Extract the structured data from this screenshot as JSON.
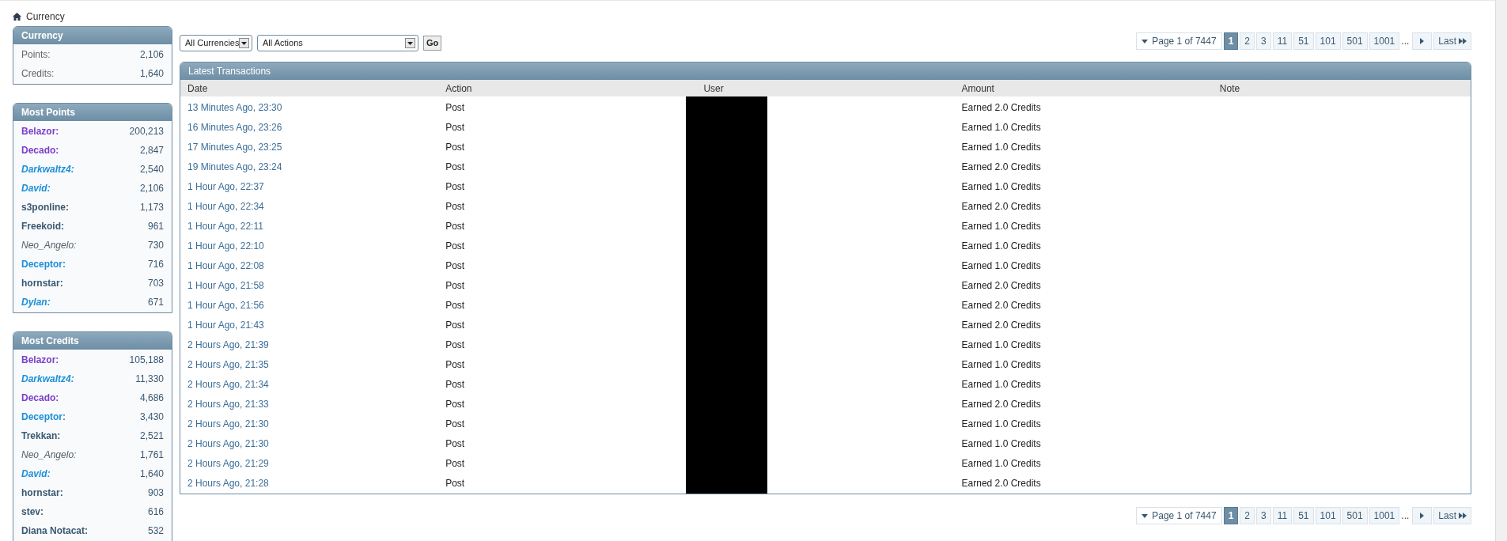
{
  "breadcrumb": {
    "label": "Currency"
  },
  "sidebar": [
    {
      "title": "Currency",
      "kind": "stats",
      "items": [
        {
          "label": "Points:",
          "value": "2,106"
        },
        {
          "label": "Credits:",
          "value": "1,640"
        }
      ]
    },
    {
      "title": "Most Points",
      "kind": "users",
      "items": [
        {
          "label": "Belazor:",
          "value": "200,213",
          "color": "#7b3fc9",
          "bold": true,
          "italic": false
        },
        {
          "label": "Decado:",
          "value": "2,847",
          "color": "#7b3fc9",
          "bold": true,
          "italic": false
        },
        {
          "label": "Darkwaltz4:",
          "value": "2,540",
          "color": "#1c8fd8",
          "bold": true,
          "italic": true
        },
        {
          "label": "David:",
          "value": "2,106",
          "color": "#1c8fd8",
          "bold": true,
          "italic": true
        },
        {
          "label": "s3ponline:",
          "value": "1,173",
          "color": "#3b5870",
          "bold": true,
          "italic": false
        },
        {
          "label": "Freekoid:",
          "value": "961",
          "color": "#3b5870",
          "bold": true,
          "italic": false
        },
        {
          "label": "Neo_Angelo:",
          "value": "730",
          "color": "#55606a",
          "bold": false,
          "italic": true
        },
        {
          "label": "Deceptor:",
          "value": "716",
          "color": "#1c8fd8",
          "bold": true,
          "italic": false
        },
        {
          "label": "hornstar:",
          "value": "703",
          "color": "#3b5870",
          "bold": true,
          "italic": false
        },
        {
          "label": "Dylan:",
          "value": "671",
          "color": "#1c8fd8",
          "bold": true,
          "italic": true
        }
      ]
    },
    {
      "title": "Most Credits",
      "kind": "users",
      "items": [
        {
          "label": "Belazor:",
          "value": "105,188",
          "color": "#7b3fc9",
          "bold": true,
          "italic": false
        },
        {
          "label": "Darkwaltz4:",
          "value": "11,330",
          "color": "#1c8fd8",
          "bold": true,
          "italic": true
        },
        {
          "label": "Decado:",
          "value": "4,686",
          "color": "#7b3fc9",
          "bold": true,
          "italic": false
        },
        {
          "label": "Deceptor:",
          "value": "3,430",
          "color": "#1c8fd8",
          "bold": true,
          "italic": false
        },
        {
          "label": "Trekkan:",
          "value": "2,521",
          "color": "#3b5870",
          "bold": true,
          "italic": false
        },
        {
          "label": "Neo_Angelo:",
          "value": "1,761",
          "color": "#55606a",
          "bold": false,
          "italic": true
        },
        {
          "label": "David:",
          "value": "1,640",
          "color": "#1c8fd8",
          "bold": true,
          "italic": true
        },
        {
          "label": "hornstar:",
          "value": "903",
          "color": "#3b5870",
          "bold": true,
          "italic": false
        },
        {
          "label": "stev:",
          "value": "616",
          "color": "#3b5870",
          "bold": true,
          "italic": false
        },
        {
          "label": "Diana Notacat:",
          "value": "532",
          "color": "#3b5870",
          "bold": true,
          "italic": false
        }
      ]
    }
  ],
  "filters": {
    "currency": "All Currencies",
    "action": "All Actions",
    "button": "Go"
  },
  "pagination": [
    {
      "summary": "Page 1 of 7447",
      "pages": [
        {
          "label": "1",
          "selected": true
        },
        {
          "label": "2",
          "selected": false
        },
        {
          "label": "3",
          "selected": false
        },
        {
          "label": "11",
          "selected": false
        },
        {
          "label": "51",
          "selected": false
        },
        {
          "label": "101",
          "selected": false
        },
        {
          "label": "501",
          "selected": false
        },
        {
          "label": "1001",
          "selected": false
        }
      ],
      "ellipsis": "...",
      "last": "Last"
    },
    {
      "summary": "Page 1 of 7447",
      "pages": [
        {
          "label": "1",
          "selected": true
        },
        {
          "label": "2",
          "selected": false
        },
        {
          "label": "3",
          "selected": false
        },
        {
          "label": "11",
          "selected": false
        },
        {
          "label": "51",
          "selected": false
        },
        {
          "label": "101",
          "selected": false
        },
        {
          "label": "501",
          "selected": false
        },
        {
          "label": "1001",
          "selected": false
        }
      ],
      "ellipsis": "...",
      "last": "Last"
    }
  ],
  "table": {
    "title": "Latest Transactions",
    "columns": [
      "Date",
      "Action",
      "User",
      "Amount",
      "Note"
    ],
    "user_column_redacted": true,
    "rows": [
      {
        "date": "13 Minutes Ago, 23:30",
        "action": "Post",
        "amount": "Earned 2.0 Credits"
      },
      {
        "date": "16 Minutes Ago, 23:26",
        "action": "Post",
        "amount": "Earned 1.0 Credits"
      },
      {
        "date": "17 Minutes Ago, 23:25",
        "action": "Post",
        "amount": "Earned 1.0 Credits"
      },
      {
        "date": "19 Minutes Ago, 23:24",
        "action": "Post",
        "amount": "Earned 2.0 Credits"
      },
      {
        "date": "1 Hour Ago, 22:37",
        "action": "Post",
        "amount": "Earned 1.0 Credits"
      },
      {
        "date": "1 Hour Ago, 22:34",
        "action": "Post",
        "amount": "Earned 2.0 Credits"
      },
      {
        "date": "1 Hour Ago, 22:11",
        "action": "Post",
        "amount": "Earned 1.0 Credits"
      },
      {
        "date": "1 Hour Ago, 22:10",
        "action": "Post",
        "amount": "Earned 1.0 Credits"
      },
      {
        "date": "1 Hour Ago, 22:08",
        "action": "Post",
        "amount": "Earned 1.0 Credits"
      },
      {
        "date": "1 Hour Ago, 21:58",
        "action": "Post",
        "amount": "Earned 2.0 Credits"
      },
      {
        "date": "1 Hour Ago, 21:56",
        "action": "Post",
        "amount": "Earned 2.0 Credits"
      },
      {
        "date": "1 Hour Ago, 21:43",
        "action": "Post",
        "amount": "Earned 2.0 Credits"
      },
      {
        "date": "2 Hours Ago, 21:39",
        "action": "Post",
        "amount": "Earned 1.0 Credits"
      },
      {
        "date": "2 Hours Ago, 21:35",
        "action": "Post",
        "amount": "Earned 1.0 Credits"
      },
      {
        "date": "2 Hours Ago, 21:34",
        "action": "Post",
        "amount": "Earned 1.0 Credits"
      },
      {
        "date": "2 Hours Ago, 21:33",
        "action": "Post",
        "amount": "Earned 2.0 Credits"
      },
      {
        "date": "2 Hours Ago, 21:30",
        "action": "Post",
        "amount": "Earned 1.0 Credits"
      },
      {
        "date": "2 Hours Ago, 21:30",
        "action": "Post",
        "amount": "Earned 1.0 Credits"
      },
      {
        "date": "2 Hours Ago, 21:29",
        "action": "Post",
        "amount": "Earned 1.0 Credits"
      },
      {
        "date": "2 Hours Ago, 21:28",
        "action": "Post",
        "amount": "Earned 2.0 Credits"
      }
    ]
  }
}
